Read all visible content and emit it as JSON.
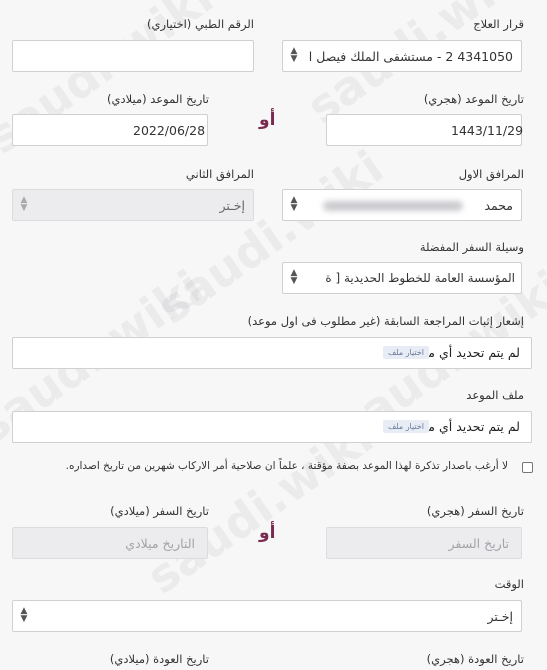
{
  "treatment_decision": {
    "label": "قرار العلاج",
    "value": "4341050 2 - مستشفى الملك فيصل ا"
  },
  "medical_number": {
    "label": "الرقم الطبي (اختياري)",
    "value": ""
  },
  "appointment_date_hijri": {
    "label": "تاريخ الموعد (هجري)",
    "value": "1443/11/29"
  },
  "appointment_date_gregorian": {
    "label": "تاريخ الموعد (ميلادي)",
    "value": "2022/06/28"
  },
  "or_label": "أو",
  "companion_first": {
    "label": "المرافق الاول",
    "value": "محمد"
  },
  "companion_second": {
    "label": "المرافق الثاني",
    "value": "إخـتر"
  },
  "travel_method": {
    "label": "وسيلة السفر المفضلة",
    "value": "المؤسسة العامة للخطوط الحديدية [ ة"
  },
  "previous_visit_notice": {
    "label": "إشعار إثبات المراجعة السابقة (غير مطلوب فى اول موعد)",
    "choose_label": "اختيار ملف",
    "no_file": "لم يتم تحديد أي ملف"
  },
  "appointment_file": {
    "label": "ملف الموعد",
    "choose_label": "اختيار ملف",
    "no_file": "لم يتم تحديد أي ملف"
  },
  "no_ticket_checkbox": {
    "label": "لا أرغب باصدار تذكرة لهذا الموعد بصفة مؤقتة ، علماً ان صلاحية أمر الاركاب شهرين من تاريخ اصداره."
  },
  "travel_date_hijri": {
    "label": "تاريخ السفر (هجري)",
    "placeholder": "تاريخ السفر"
  },
  "travel_date_gregorian": {
    "label": "تاريخ السفر (ميلادي)",
    "placeholder": "التاريخ ميلادي"
  },
  "time": {
    "label": "الوقت",
    "value": "إخـتر"
  },
  "return_date_hijri": {
    "label": "تاريخ العودة (هجري)"
  },
  "return_date_gregorian": {
    "label": "تاريخ العودة (ميلادي)"
  },
  "watermark": "saudi.wiki",
  "colors": {
    "accent": "#7b2a4f",
    "input_border": "#cfcfd4",
    "disabled_bg": "#ececee"
  }
}
